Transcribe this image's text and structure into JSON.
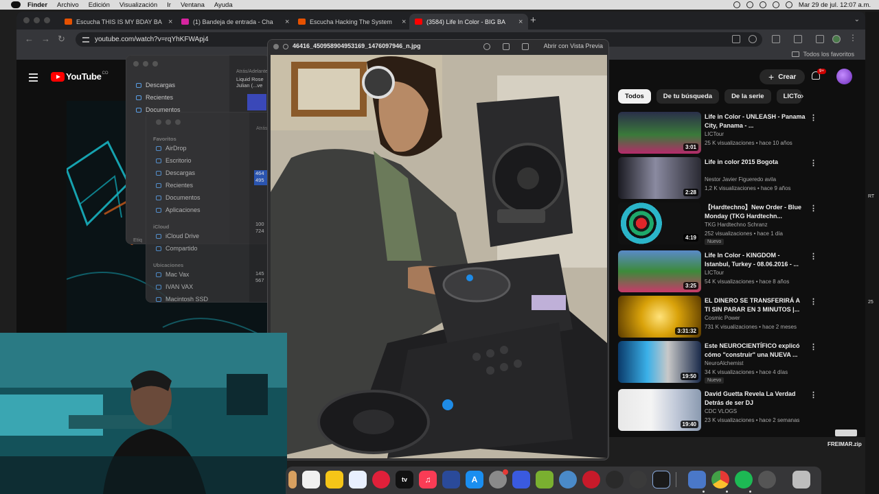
{
  "menubar": {
    "items": [
      "Finder",
      "Archivo",
      "Edición",
      "Visualización",
      "Ir",
      "Ventana",
      "Ayuda"
    ],
    "clock": "Mar 29 de jul.  12:07 a.m."
  },
  "browser": {
    "tabs": [
      {
        "title": "Escucha THIS IS MY BDAY BA",
        "color": "#e65100"
      },
      {
        "title": "(1) Bandeja de entrada - Cha",
        "color": "#d6249f"
      },
      {
        "title": "Escucha Hacking The System",
        "color": "#e65100"
      },
      {
        "title": "(3584) Life In Color - BIG BA",
        "color": "#ff0000"
      }
    ],
    "url": "youtube.com/watch?v=rqYhKFWApj4",
    "bookmarks_label": "Todos los favoritos"
  },
  "youtube": {
    "logo": "YouTube",
    "logo_sup": "CO",
    "create_label": "Crear",
    "notif_badge": "9+",
    "chips": [
      "Todos",
      "De tu búsqueda",
      "De la serie",
      "LICTour"
    ],
    "recommendations": [
      {
        "title": "Life in Color - UNLEASH - Panama City, Panama - ...",
        "channel": "LICTour",
        "meta": "25 K visualizaciones • hace 10 años",
        "duration": "3:01",
        "badge": ""
      },
      {
        "title": "Life in color 2015 Bogota",
        "channel": "Nestor Javier Figueredo avila",
        "meta": "1,2 K visualizaciones • hace 9 años",
        "duration": "2:28",
        "badge": ""
      },
      {
        "title": "【Hardtechno】New Order - Blue Monday (TKG Hardtechn...",
        "channel": "TKG Hardtechno Schranz",
        "meta": "252 visualizaciones • hace 1 día",
        "duration": "4:19",
        "badge": "Nuevo"
      },
      {
        "title": "Life In Color - KINGDOM - Istanbul, Turkey - 08.06.2016 - ...",
        "channel": "LICTour",
        "meta": "54 K visualizaciones • hace 8 años",
        "duration": "3:25",
        "badge": ""
      },
      {
        "title": "EL DINERO SE TRANSFERIRÁ A TI SIN PARAR EN 3 MINUTOS |...",
        "channel": "Cosmic Power",
        "meta": "731 K visualizaciones • hace 2 meses",
        "duration": "3:31:32",
        "badge": ""
      },
      {
        "title": "Este NEUROCIENTÍFICO explicó cómo \"construir\" una NUEVA ...",
        "channel": "NeuroAlchemist",
        "meta": "34 K visualizaciones • hace 4 días",
        "duration": "19:50",
        "badge": "Nuevo"
      },
      {
        "title": "David Guetta Revela La Verdad Detrás de ser DJ",
        "channel": "CDC VLOGS",
        "meta": "23 K visualizaciones • hace 2 semanas",
        "duration": "19:40",
        "badge": ""
      }
    ]
  },
  "finder_back": {
    "sidebar": [
      "Descargas",
      "Recientes",
      "Documentos"
    ],
    "col_header": "Atrás/Adelante",
    "files": [
      "Liquid Rose",
      "Julian (...ve"
    ],
    "bottom": "Etiq"
  },
  "finder_front": {
    "favorites_head": "Favoritos",
    "favorites": [
      "AirDrop",
      "Escritorio",
      "Descargas",
      "Recientes",
      "Documentos",
      "Aplicaciones"
    ],
    "icloud_head": "iCloud",
    "icloud": [
      "iCloud Drive",
      "Compartido"
    ],
    "locations_head": "Ubicaciones",
    "locations": [
      "Mac Vax",
      "IVAN VAX",
      "Macintosh SSD"
    ],
    "col_header": "Atrás",
    "values": [
      "464",
      "495",
      "100",
      "724",
      "145",
      "567"
    ]
  },
  "preview": {
    "filename": "46416_450958904953169_1476097946_n.jpg",
    "open_label": "Abrir con Vista Previa"
  },
  "desktop": {
    "zip_label": "FREIMAR.zip",
    "edge_text_1": "RT",
    "edge_text_2": "25"
  }
}
